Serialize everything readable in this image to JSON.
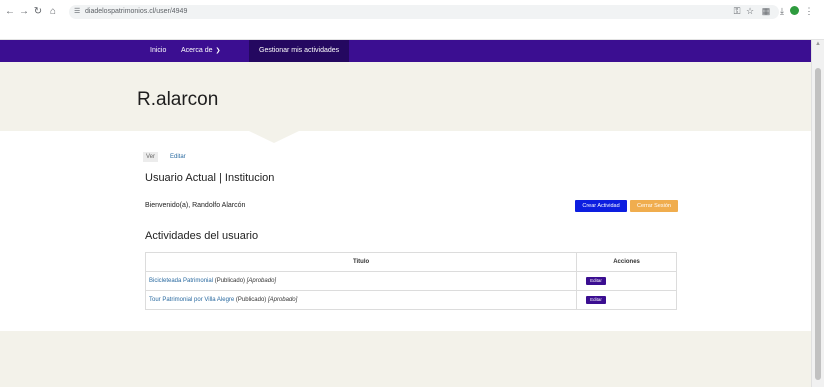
{
  "browser": {
    "url": "diadelospatrimonios.cl/user/4949"
  },
  "nav": {
    "items": [
      {
        "label": "Inicio"
      },
      {
        "label": "Acerca de"
      },
      {
        "label": "Gestionar mis actividades"
      }
    ]
  },
  "hero": {
    "title": "R.alarcon"
  },
  "tabs": [
    {
      "label": "Ver"
    },
    {
      "label": "Editar"
    }
  ],
  "user_section": {
    "title": "Usuario Actual | Institucion",
    "welcome": "Bienvenido(a), Randolfo Alarcón",
    "create_button": "Crear Actividad",
    "logout_button": "Cerrar Sesión"
  },
  "activities": {
    "title": "Actividades del usuario",
    "columns": {
      "title": "Titulo",
      "actions": "Acciones"
    },
    "rows": [
      {
        "name": "Bicicleteada Patrimonial",
        "status": " (Publicado) ",
        "approval": "[Aprobado]",
        "action": "Editar"
      },
      {
        "name": "Tour Patrimonial por Villa Alegre",
        "status": " (Publicado) ",
        "approval": "[Aprobado]",
        "action": "Editar"
      }
    ]
  },
  "colors": {
    "brand": "#3b0e91",
    "primary_button": "#0d1ee0",
    "warning_button": "#f0ad4e",
    "hero_bg": "#f3f2ea"
  }
}
